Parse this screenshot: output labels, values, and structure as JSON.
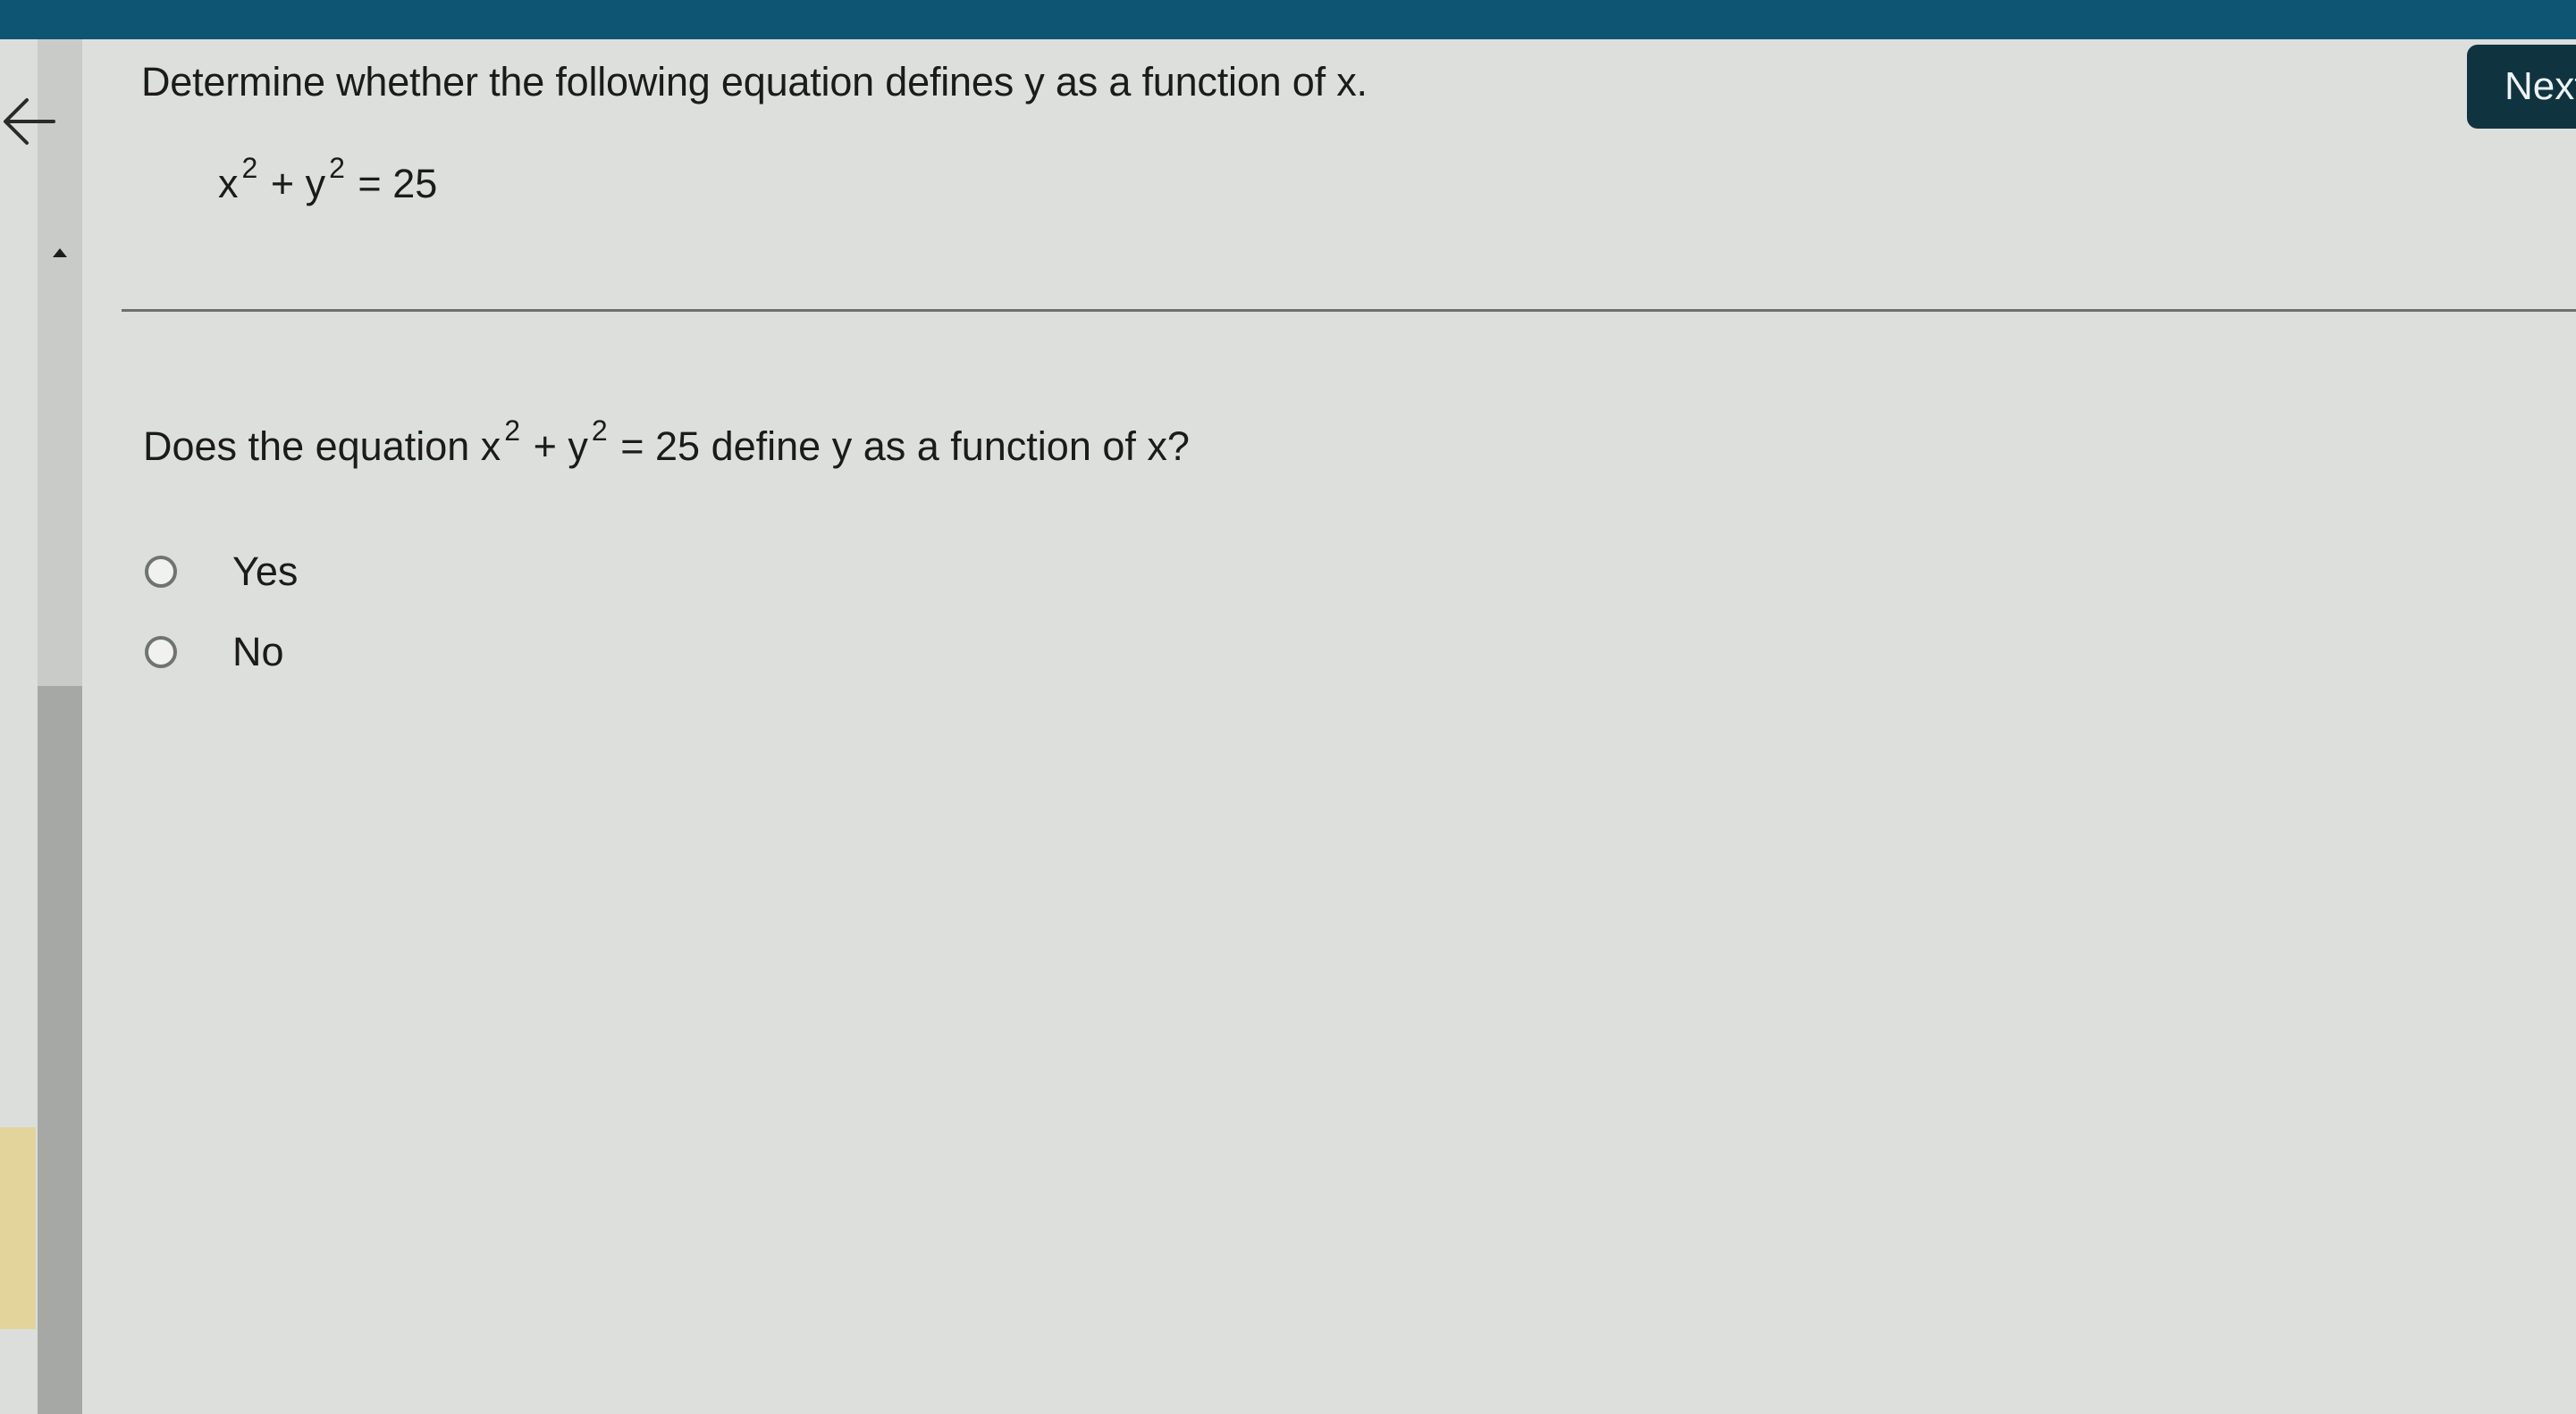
{
  "header": {
    "back_icon": "arrow-left-icon",
    "next_label": "Next"
  },
  "question": {
    "prompt": "Determine whether the following equation defines y as a function of x.",
    "equation": {
      "base1": "x",
      "exp1": "2",
      "op": "+",
      "base2": "y",
      "exp2": "2",
      "rhs": "= 25"
    },
    "sub_prompt_start": "Does the equation",
    "sub_prompt_end": "define y as a function of x?",
    "options": [
      {
        "label": "Yes",
        "selected": false
      },
      {
        "label": "No",
        "selected": false
      }
    ]
  },
  "colors": {
    "topbar": "#0e5573",
    "next_button": "#10343f",
    "background": "#dddfdc"
  }
}
